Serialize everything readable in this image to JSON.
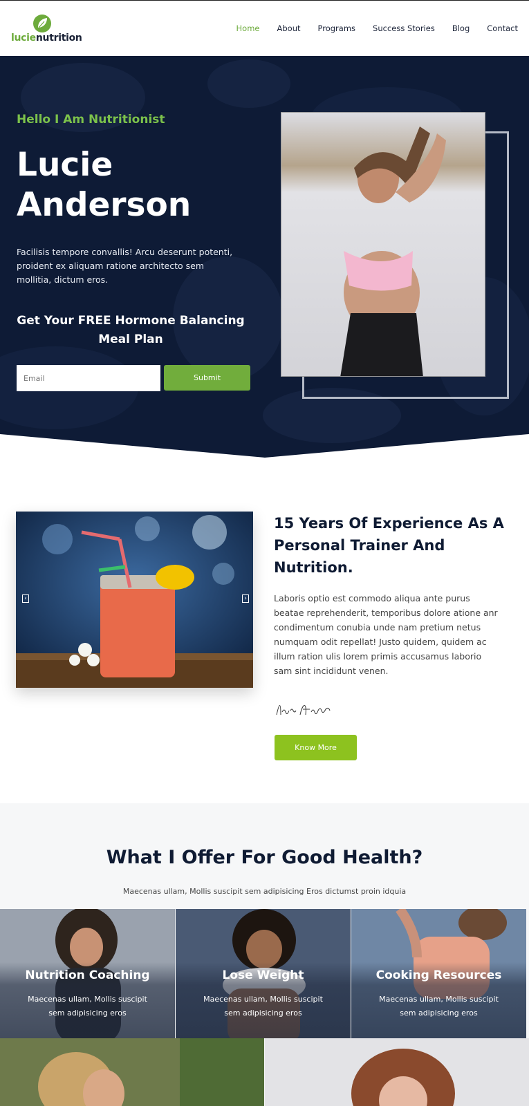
{
  "brand": {
    "logo_part1": "lucie",
    "logo_part2": "nutrition",
    "accent": "#6dab3c",
    "navy": "#0e1b36"
  },
  "nav": {
    "items": [
      "Home",
      "About",
      "Programs",
      "Success Stories",
      "Blog",
      "Contact"
    ],
    "active": "Home"
  },
  "hero": {
    "kicker": "Hello I Am Nutritionist",
    "name_line1": "Lucie",
    "name_line2": "Anderson",
    "description": "Facilisis tempore convallis! Arcu deserunt potenti, proident ex aliquam ratione architecto sem mollitia, dictum eros.",
    "cta_title": "Get Your FREE Hormone Balancing Meal Plan",
    "email_placeholder": "Email",
    "submit_label": "Submit",
    "photo_icon": "woman-fitness-photo"
  },
  "about": {
    "title": "15 Years Of Experience As A Personal Trainer And Nutrition.",
    "text": "Laboris optio est commodo aliqua ante purus beatae reprehenderit, temporibus dolore atione anr condimentum conubia unde nam pretium  netus numquam odit repellat! Justo quidem, quidem ac illum ration ulis lorem primis accusamus laborio sam sint incididunt venen.",
    "signature": "Lucie Anderson",
    "button_label": "Know More",
    "slider_prev_icon": "chevron-left-icon",
    "slider_next_icon": "chevron-right-icon"
  },
  "offer": {
    "title": "What I Offer For Good Health?",
    "subtitle": "Maecenas ullam, Mollis suscipit sem adipisicing Eros dictumst proin idquia",
    "cards": [
      {
        "title": "Nutrition Coaching",
        "text": "Maecenas ullam, Mollis suscipit sem adipisicing eros"
      },
      {
        "title": "Lose Weight",
        "text": "Maecenas ullam, Mollis suscipit sem adipisicing eros"
      },
      {
        "title": "Cooking Resources",
        "text": "Maecenas ullam, Mollis suscipit sem adipisicing eros"
      }
    ]
  }
}
